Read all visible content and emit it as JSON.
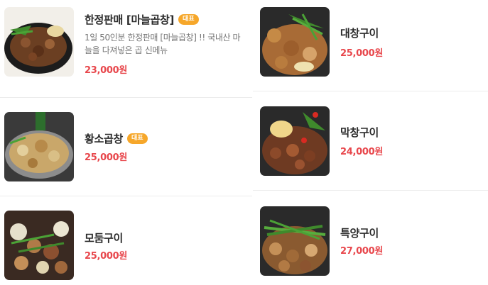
{
  "menu": [
    {
      "name": "한정판매 [마늘곱창]",
      "badge": "대표",
      "description": "1일 50인분 한정판매 [마늘곱창] !! 국내산 마늘을 다져넣은 곱 신메뉴",
      "price": "23,000원"
    },
    {
      "name": "대창구이",
      "price": "25,000원"
    },
    {
      "name": "황소곱창",
      "badge": "대표",
      "price": "25,000원"
    },
    {
      "name": "막창구이",
      "price": "24,000원"
    },
    {
      "name": "모둠구이",
      "price": "25,000원"
    },
    {
      "name": "특양구이",
      "price": "27,000원"
    }
  ],
  "icons": {
    "food_photo": "food-photo"
  },
  "colors": {
    "price": "#e8474c",
    "badge": "#f6a72a"
  }
}
